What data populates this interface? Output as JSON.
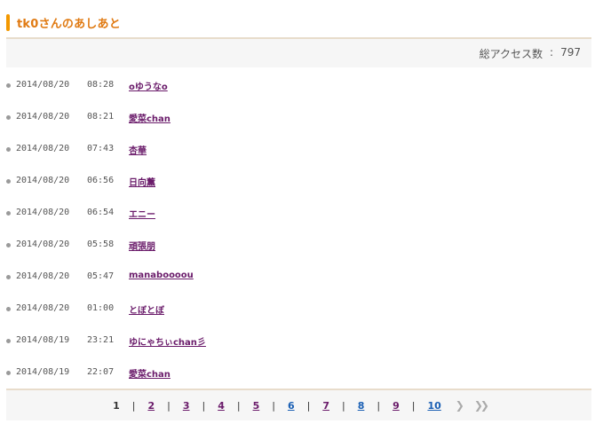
{
  "header": {
    "title": "tk0さんのあしあと",
    "accent_color": "#f39800"
  },
  "stats": {
    "label": "総アクセス数",
    "separator": ":",
    "value": "797"
  },
  "entries": [
    {
      "date": "2014/08/20",
      "time": "08:28",
      "name": "oゆうなo"
    },
    {
      "date": "2014/08/20",
      "time": "08:21",
      "name": "愛菜chan"
    },
    {
      "date": "2014/08/20",
      "time": "07:43",
      "name": "杏華"
    },
    {
      "date": "2014/08/20",
      "time": "06:56",
      "name": "日向薫"
    },
    {
      "date": "2014/08/20",
      "time": "06:54",
      "name": "エニー"
    },
    {
      "date": "2014/08/20",
      "time": "05:58",
      "name": "頑張朋"
    },
    {
      "date": "2014/08/20",
      "time": "05:47",
      "name": "manaboooou"
    },
    {
      "date": "2014/08/20",
      "time": "01:00",
      "name": "とぼとぼ"
    },
    {
      "date": "2014/08/19",
      "time": "23:21",
      "name": "ゆにゃちぃchan彡"
    },
    {
      "date": "2014/08/19",
      "time": "22:07",
      "name": "愛菜chan"
    }
  ],
  "pagination": {
    "pages": [
      "1",
      "2",
      "3",
      "4",
      "5",
      "6",
      "7",
      "8",
      "9",
      "10"
    ],
    "current": "1",
    "next_icon": "next-arrow-icon",
    "last_icon": "last-arrow-icon"
  }
}
